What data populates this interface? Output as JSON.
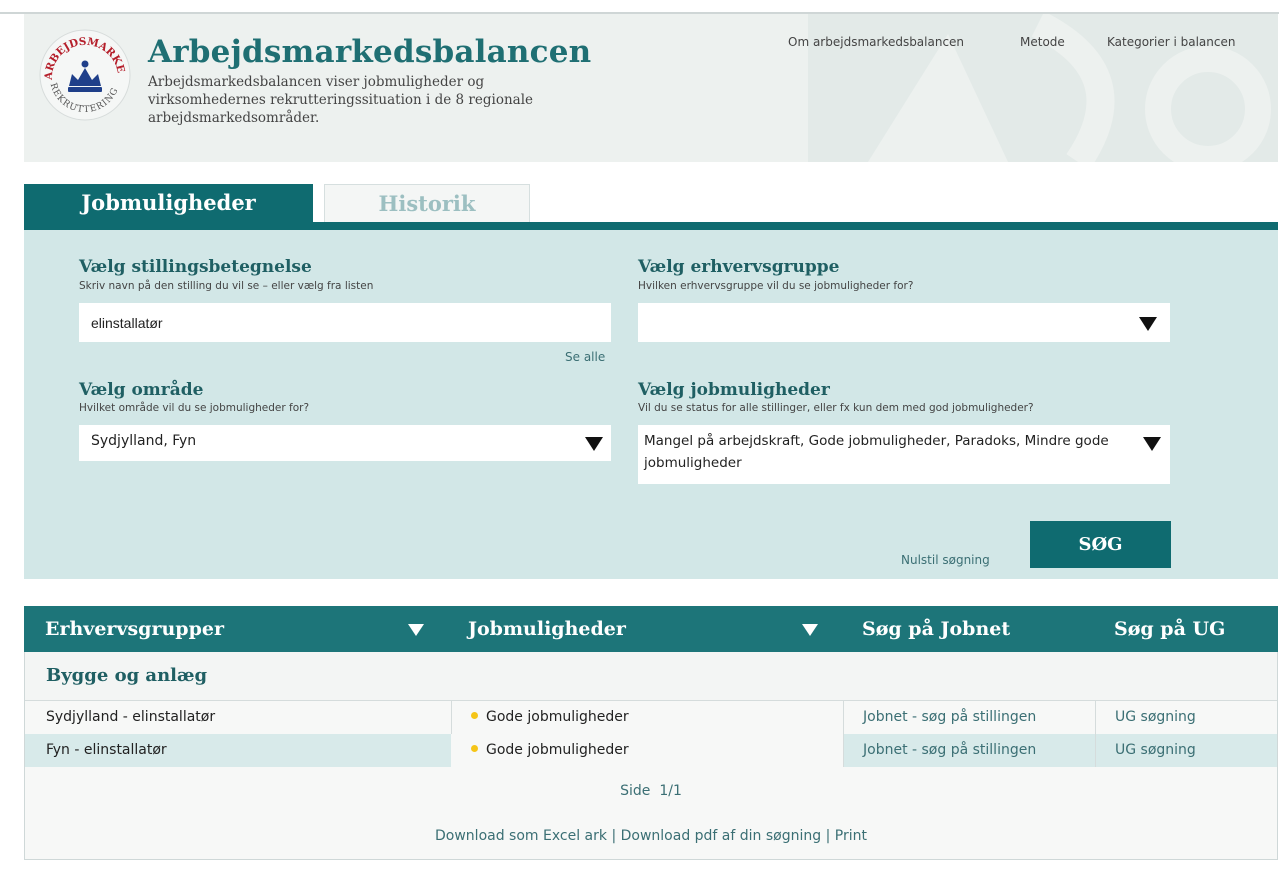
{
  "header": {
    "logo_text": "ARBEJDSMARKED REKRUTTERING",
    "title": "Arbejdsmarkedsbalancen",
    "description": "Arbejdsmarkedsbalancen viser jobmuligheder og virksomhedernes rekrutteringssituation i de 8 regionale arbejdsmarkedsområder.",
    "nav": [
      "Om arbejdsmarkedsbalancen",
      "Metode",
      "Kategorier i balancen"
    ]
  },
  "tabs": [
    {
      "label": "Jobmuligheder",
      "active": true
    },
    {
      "label": "Historik",
      "active": false
    }
  ],
  "search": {
    "stilling": {
      "label": "Vælg stillingsbetegnelse",
      "hint": "Skriv navn på den stilling du vil se – eller vælg fra listen",
      "value": "elinstallatør",
      "see_all": "Se alle"
    },
    "erhverv": {
      "label": "Vælg erhvervsgruppe",
      "hint": "Hvilken erhvervsgruppe vil du se jobmuligheder for?",
      "value": ""
    },
    "omraade": {
      "label": "Vælg område",
      "hint": "Hvilket område vil du se jobmuligheder for?",
      "value": "Sydjylland, Fyn"
    },
    "jobmuligheder": {
      "label": "Vælg jobmuligheder",
      "hint": "Vil du se status for alle stillinger, eller fx kun dem med god jobmuligheder?",
      "value": "Mangel på arbejdskraft, Gode jobmuligheder, Paradoks, Mindre gode jobmuligheder"
    },
    "reset_label": "Nulstil søgning",
    "submit_label": "SØG"
  },
  "results": {
    "columns": [
      "Erhvervsgrupper",
      "Jobmuligheder",
      "Søg på Jobnet",
      "Søg på UG"
    ],
    "group": "Bygge og anlæg",
    "rows": [
      {
        "name": "Sydjylland - elinstallatør",
        "status": "Gode jobmuligheder",
        "jobnet": "Jobnet - søg på stillingen",
        "ug": "UG søgning"
      },
      {
        "name": "Fyn - elinstallatør",
        "status": "Gode jobmuligheder",
        "jobnet": "Jobnet - søg på stillingen",
        "ug": "UG søgning"
      }
    ],
    "pager": "Side  1/1",
    "downloads": {
      "excel": "Download som Excel ark",
      "pdf": "Download pdf af din søgning",
      "print": "Print",
      "separator": "|"
    }
  },
  "colors": {
    "primary": "#0f6b70",
    "panel": "#d2e7e7",
    "status_dot": "#f5c518"
  }
}
